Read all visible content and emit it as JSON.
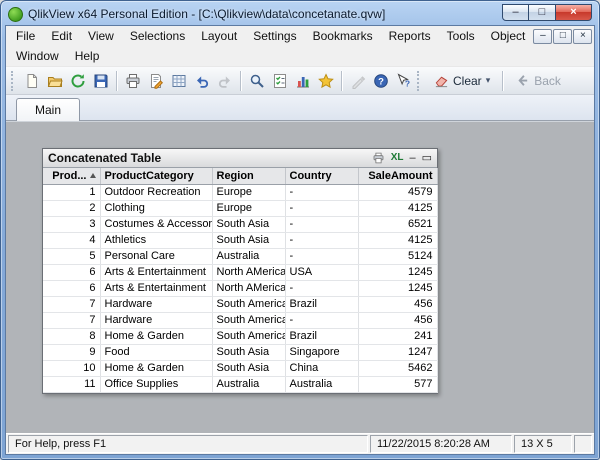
{
  "window": {
    "title": "QlikView x64 Personal Edition - [C:\\Qlikview\\data\\concetanate.qvw]"
  },
  "icons": {
    "minimize": "–",
    "maximize": "□",
    "close": "×",
    "dropdown_caret": "▾",
    "mdi_minimize": "–",
    "mdi_restore": "□",
    "mdi_close": "×",
    "caption_minimize": "–",
    "caption_restore": "▭"
  },
  "menu": {
    "row1": [
      "File",
      "Edit",
      "View",
      "Selections",
      "Layout",
      "Settings",
      "Bookmarks",
      "Reports",
      "Tools",
      "Object"
    ],
    "row2": [
      "Window",
      "Help"
    ]
  },
  "toolbar": {
    "buttons": [
      {
        "name": "new-file"
      },
      {
        "name": "open"
      },
      {
        "name": "reload"
      },
      {
        "name": "save"
      },
      {
        "name": "print"
      },
      {
        "name": "edit-script"
      },
      {
        "name": "design-toggle"
      },
      {
        "name": "undo"
      },
      {
        "name": "redo",
        "disabled": true
      },
      {
        "name": "search"
      },
      {
        "name": "current-selections"
      },
      {
        "name": "quick-chart"
      },
      {
        "name": "bookmark"
      },
      {
        "name": "notes",
        "disabled": true
      },
      {
        "name": "help"
      },
      {
        "name": "context-help"
      }
    ],
    "clear_label": "Clear",
    "back_label": "Back"
  },
  "tabs": [
    {
      "label": "Main"
    }
  ],
  "table": {
    "caption": "Concatenated Table",
    "excel_label": "XL",
    "columns": [
      {
        "label": "Prod...",
        "align": "right",
        "sort": "asc"
      },
      {
        "label": "ProductCategory",
        "align": "left"
      },
      {
        "label": "Region",
        "align": "left"
      },
      {
        "label": "Country",
        "align": "left"
      },
      {
        "label": "SaleAmount",
        "align": "right"
      }
    ],
    "rows": [
      [
        "1",
        "Outdoor Recreation",
        "Europe",
        "-",
        "4579"
      ],
      [
        "2",
        "Clothing",
        "Europe",
        "-",
        "4125"
      ],
      [
        "3",
        "Costumes & Accessories",
        "South Asia",
        "-",
        "6521"
      ],
      [
        "4",
        "Athletics",
        "South Asia",
        "-",
        "4125"
      ],
      [
        "5",
        "Personal Care",
        "Australia",
        "-",
        "5124"
      ],
      [
        "6",
        "Arts & Entertainment",
        "North AMerica",
        "USA",
        "1245"
      ],
      [
        "6",
        "Arts & Entertainment",
        "North AMerica",
        "-",
        "1245"
      ],
      [
        "7",
        "Hardware",
        "South America",
        "Brazil",
        "456"
      ],
      [
        "7",
        "Hardware",
        "South America",
        "-",
        "456"
      ],
      [
        "8",
        "Home & Garden",
        "South America",
        "Brazil",
        "241"
      ],
      [
        "9",
        "Food",
        "South Asia",
        "Singapore",
        "1247"
      ],
      [
        "10",
        "Home & Garden",
        "South Asia",
        "China",
        "5462"
      ],
      [
        "11",
        "Office Supplies",
        "Australia",
        "Australia",
        "577"
      ]
    ]
  },
  "statusbar": {
    "help_text": "For Help, press F1",
    "timestamp": "11/22/2015 8:20:28 AM",
    "dimensions": "13 X 5"
  }
}
